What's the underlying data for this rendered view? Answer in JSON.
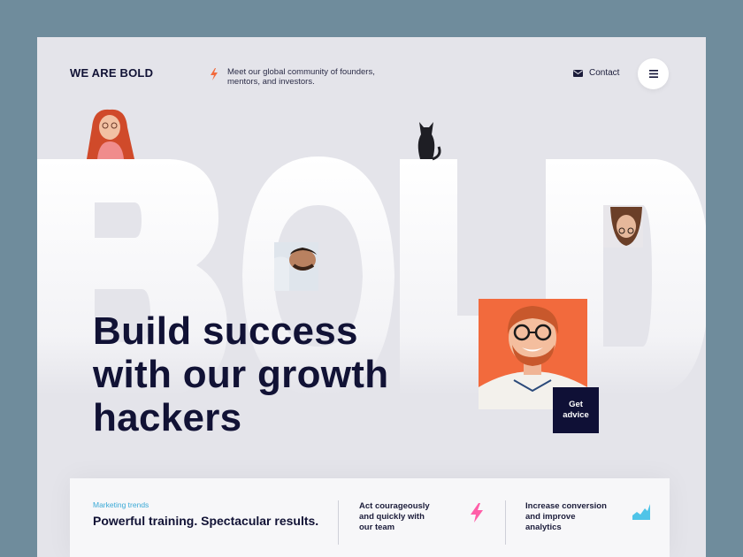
{
  "header": {
    "logo": "WE ARE BOLD",
    "tagline": "Meet our global community of founders, mentors, and investors.",
    "contact_label": "Contact"
  },
  "hero": {
    "big_word": "BOLD",
    "headline_lines": [
      "Build success",
      "with our growth",
      "hackers"
    ],
    "cta_line1": "Get",
    "cta_line2": "advice"
  },
  "bottom": {
    "eyebrow": "Marketing trends",
    "title": "Powerful training. Spectacular results.",
    "feature1": [
      "Act courageously",
      "and quickly with",
      "our team"
    ],
    "feature2": [
      "Increase conversion",
      "and improve",
      "analytics"
    ]
  },
  "colors": {
    "accent_orange": "#f26a3d",
    "navy": "#111235",
    "pink": "#ff5ea8",
    "sky": "#4fc4e8"
  },
  "icons": [
    "bolt-icon",
    "mail-icon",
    "menu-icon",
    "lightning-icon",
    "chart-icon"
  ]
}
